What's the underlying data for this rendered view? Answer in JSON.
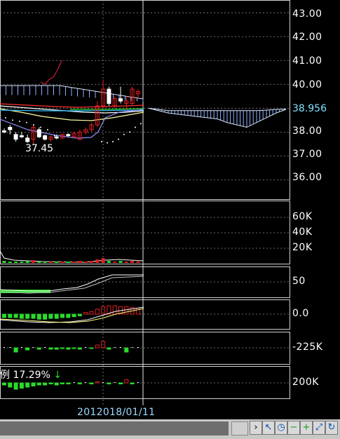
{
  "chart_data": [
    {
      "type": "candlestick",
      "panel": "price",
      "y_ticks": [
        "43.00",
        "42.00",
        "41.00",
        "40.00",
        "39.00",
        "38.00",
        "37.00",
        "36.00"
      ],
      "ylim": [
        35.6,
        43.3
      ],
      "last_price": "38.956",
      "low_label": "37.45",
      "candles": [
        {
          "o": 38.05,
          "h": 38.15,
          "l": 37.95,
          "c": 38.0
        },
        {
          "o": 38.2,
          "h": 38.3,
          "l": 37.9,
          "c": 38.1
        },
        {
          "o": 37.9,
          "h": 38.0,
          "l": 37.6,
          "c": 37.7
        },
        {
          "o": 37.85,
          "h": 38.0,
          "l": 37.75,
          "c": 37.8
        },
        {
          "o": 37.75,
          "h": 37.9,
          "l": 37.55,
          "c": 37.6
        },
        {
          "o": 37.7,
          "h": 38.3,
          "l": 37.45,
          "c": 38.2
        },
        {
          "o": 38.1,
          "h": 38.2,
          "l": 37.75,
          "c": 37.8
        },
        {
          "o": 37.85,
          "h": 37.9,
          "l": 37.65,
          "c": 37.7
        },
        {
          "o": 37.7,
          "h": 37.85,
          "l": 37.6,
          "c": 37.8
        },
        {
          "o": 37.8,
          "h": 37.9,
          "l": 37.7,
          "c": 37.75
        },
        {
          "o": 37.75,
          "h": 37.95,
          "l": 37.7,
          "c": 37.9
        },
        {
          "o": 37.9,
          "h": 37.95,
          "l": 37.8,
          "c": 37.85
        },
        {
          "o": 37.8,
          "h": 38.0,
          "l": 37.75,
          "c": 37.95
        },
        {
          "o": 37.7,
          "h": 38.1,
          "l": 37.65,
          "c": 38.0
        },
        {
          "o": 38.0,
          "h": 38.2,
          "l": 37.9,
          "c": 38.1
        },
        {
          "o": 38.1,
          "h": 38.4,
          "l": 38.0,
          "c": 38.3
        },
        {
          "o": 38.3,
          "h": 39.3,
          "l": 38.2,
          "c": 39.1
        },
        {
          "o": 39.1,
          "h": 40.2,
          "l": 39.0,
          "c": 39.8
        },
        {
          "o": 39.8,
          "h": 39.9,
          "l": 39.1,
          "c": 39.2
        },
        {
          "o": 39.1,
          "h": 39.5,
          "l": 39.0,
          "c": 39.4
        },
        {
          "o": 39.4,
          "h": 39.9,
          "l": 39.2,
          "c": 39.3
        },
        {
          "o": 39.2,
          "h": 39.5,
          "l": 38.9,
          "c": 39.3
        },
        {
          "o": 39.2,
          "h": 39.9,
          "l": 39.1,
          "c": 39.8
        },
        {
          "o": 39.6,
          "h": 39.8,
          "l": 39.4,
          "c": 39.7
        }
      ],
      "red_line": [
        40.1,
        40.0,
        40.2,
        40.3,
        40.6,
        41.0
      ],
      "dots": [
        38.6,
        38.5,
        38.45,
        38.4,
        38.3,
        38.2,
        38.1,
        37.85,
        37.6,
        37.55,
        37.6,
        37.7,
        37.9,
        38.0,
        38.2,
        38.35
      ],
      "cloud_top": [
        39.0,
        38.9,
        38.8,
        38.75,
        38.7,
        38.65,
        38.6,
        38.55,
        38.4,
        38.3,
        38.2,
        38.4,
        38.6,
        38.8,
        38.95
      ],
      "cloud_bottom": [
        39.0,
        38.95,
        38.9,
        38.9,
        38.9,
        38.9,
        38.9,
        38.9,
        38.9,
        38.9,
        38.9,
        38.9,
        38.92,
        38.95,
        38.96
      ]
    },
    {
      "type": "bar",
      "panel": "volume",
      "y_ticks": [
        "60K",
        "40K",
        "20K"
      ],
      "ylim": [
        0,
        75000
      ]
    },
    {
      "type": "line",
      "panel": "oscillator",
      "y_ticks": [
        "50"
      ],
      "ylim": [
        0,
        100
      ]
    },
    {
      "type": "bar",
      "panel": "macd",
      "y_ticks": [
        "0.0"
      ],
      "ylim": [
        -1,
        1
      ]
    },
    {
      "type": "bar",
      "panel": "indicator4",
      "y_ticks": [
        "-225K"
      ]
    },
    {
      "type": "bar",
      "panel": "indicator5",
      "y_ticks": [
        "200K"
      ],
      "label": "例 17.29%"
    }
  ],
  "date_label": "2018/01/11",
  "date_prev_fragment": "201",
  "colors": {
    "up": "#e02020",
    "down": "#ffffff",
    "grid": "#8a8a8a",
    "cloud": "#8fb2ff",
    "green": "#2adb2a",
    "accent": "#7fe0ff"
  },
  "toolbar": {
    "buttons": [
      "scroll-right",
      "cursor",
      "clock",
      "zoom-out",
      "zoom-in",
      "link",
      "refresh"
    ]
  }
}
